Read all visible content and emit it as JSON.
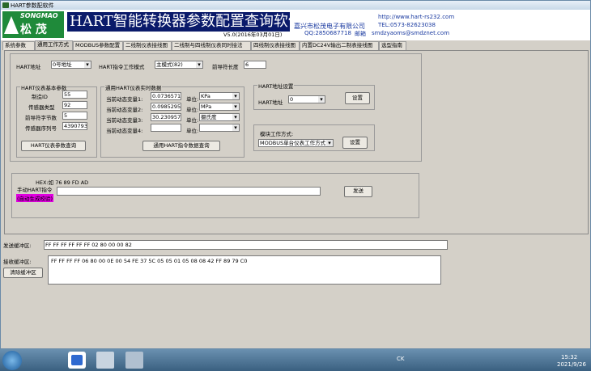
{
  "window": {
    "title": "HART参数配软件"
  },
  "banner": {
    "logo_en": "SONGMAO",
    "logo_cn": "松 茂",
    "title": "HART智能转换器参数配置查询软件",
    "version": "V5.0(2016年03月01日)",
    "company": "嘉兴市松茂电子有限公司",
    "website": "http://www.hart-rs232.com",
    "tel": "TEL:0573-82623038",
    "qq": "QQ:2850687718",
    "email_label": "邮箱",
    "email": "smdzyaoms@smdznet.com"
  },
  "tabs": [
    "系统参数",
    "通用工作方式",
    "MODBUS参数配置",
    "二线制仪表接线图",
    "二线制与四线制仪表同时接法",
    "四线制仪表接线图",
    "内置DC24V输出二制表接线图",
    "选型指南"
  ],
  "top_row": {
    "hart_addr_label": "HART地址",
    "hart_addr_value": "0号地址",
    "cmd_mode_label": "HART指令工作模式",
    "cmd_mode_value": "主模式(82)",
    "preamble_label": "前导符长度",
    "preamble_value": "6"
  },
  "basic_params": {
    "title": "HART仪表基本参数",
    "rows": [
      {
        "label": "制造ID",
        "value": "55"
      },
      {
        "label": "传感器类型",
        "value": "92"
      },
      {
        "label": "前导符字节数",
        "value": "5"
      },
      {
        "label": "传感器序列号",
        "value": "4390793"
      }
    ],
    "query_button": "HART仪表参数查询"
  },
  "realtime": {
    "title": "通用HART仪表实时数据",
    "unit_label": "单位:",
    "rows": [
      {
        "label": "当前动态变量1:",
        "value": "0.0736571",
        "unit": "KPa"
      },
      {
        "label": "当前动态变量2:",
        "value": "0.0985295",
        "unit": "MPa"
      },
      {
        "label": "当前动态变量3:",
        "value": "30.230957",
        "unit": "摄氏度"
      },
      {
        "label": "当前动态变量4:",
        "value": "",
        "unit": ""
      }
    ],
    "query_button": "通用HART指令数据查询"
  },
  "hart_addr_settings": {
    "title": "HART地址设置",
    "label": "HART地址",
    "value": "0",
    "button": "设置"
  },
  "module_mode": {
    "label": "模块工作方式:",
    "value": "MODBUS单台仪表工作方式",
    "button": "设置"
  },
  "manual_cmd": {
    "hex_hint": "HEX:如 76 89 FD AD",
    "label": "手动HART指令",
    "value": "",
    "send_button": "发送",
    "auto_checksum": "(自动生成校验)"
  },
  "buffers": {
    "send_label": "发送缓冲区:",
    "send_value": "FF FF FF FF FF FF 02 80 00 00 82",
    "recv_label": "接收缓冲区:",
    "recv_value": "FF FF FF FF 06 80 00 0E 00 54 FE 37 5C 05 05 01 05 08 08 42 FF 89 79 C0",
    "clear_button": "清除缓冲区"
  },
  "taskbar": {
    "tray_text": "CK",
    "time": "15:32",
    "date": "2021/9/26"
  }
}
